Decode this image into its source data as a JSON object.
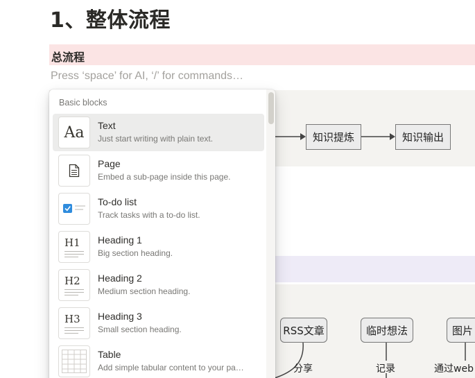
{
  "page": {
    "title": "1、整体流程",
    "callout_title": "总流程",
    "placeholder": "Press ‘space’ for AI, ‘/’ for commands…"
  },
  "diagram_top": {
    "nodes": [
      "知识提炼",
      "知识输出"
    ]
  },
  "diagram_bottom": {
    "nodes": [
      "RSS文章",
      "临时想法",
      "图片"
    ],
    "edge_labels": [
      "分享",
      "记录",
      "通过web"
    ]
  },
  "menu": {
    "section_label": "Basic blocks",
    "items": [
      {
        "title": "Text",
        "description": "Just start writing with plain text.",
        "icon": "text-aa-icon"
      },
      {
        "title": "Page",
        "description": "Embed a sub-page inside this page.",
        "icon": "page-icon"
      },
      {
        "title": "To-do list",
        "description": "Track tasks with a to-do list.",
        "icon": "todo-checkbox-icon"
      },
      {
        "title": "Heading 1",
        "description": "Big section heading.",
        "icon": "heading1-icon"
      },
      {
        "title": "Heading 2",
        "description": "Medium section heading.",
        "icon": "heading2-icon"
      },
      {
        "title": "Heading 3",
        "description": "Small section heading.",
        "icon": "heading3-icon"
      },
      {
        "title": "Table",
        "description": "Add simple tabular content to your pa…",
        "icon": "table-icon"
      }
    ],
    "icon_text": {
      "text": "Aa",
      "h1": "H1",
      "h2": "H2",
      "h3": "H3"
    }
  },
  "colors": {
    "callout_pink": "#fbe4e4",
    "diagram_bg": "#f4f3f0",
    "purple_block": "#eeebf7",
    "checkbox_blue": "#2f8cdd",
    "active_item": "#ececeb"
  }
}
